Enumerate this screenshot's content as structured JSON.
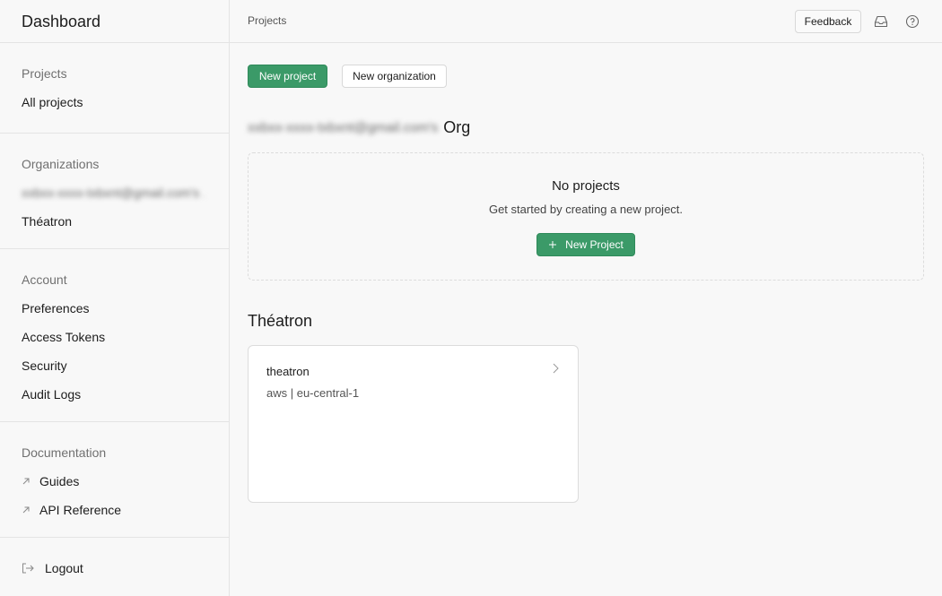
{
  "sidebar": {
    "title": "Dashboard",
    "projects": {
      "title": "Projects",
      "items": [
        {
          "label": "All projects"
        }
      ]
    },
    "organizations": {
      "title": "Organizations",
      "items": [
        {
          "label": "xxbxx-xxxx-txbxnt@gmail.com's ..."
        },
        {
          "label": "Théatron"
        }
      ]
    },
    "account": {
      "title": "Account",
      "items": [
        {
          "label": "Preferences"
        },
        {
          "label": "Access Tokens"
        },
        {
          "label": "Security"
        },
        {
          "label": "Audit Logs"
        }
      ]
    },
    "documentation": {
      "title": "Documentation",
      "items": [
        {
          "label": "Guides",
          "icon": "external-link-icon"
        },
        {
          "label": "API Reference",
          "icon": "external-link-icon"
        }
      ]
    },
    "logout": {
      "label": "Logout",
      "icon": "logout-icon"
    }
  },
  "topbar": {
    "breadcrumb": "Projects",
    "feedback_label": "Feedback",
    "icons": [
      "inbox-icon",
      "help-icon"
    ]
  },
  "main": {
    "new_project_label": "New project",
    "new_org_label": "New organization",
    "orgs": [
      {
        "name_prefix": "xxbxx-xxxx-txbxnt@gmail.com's",
        "name_suffix": "Org",
        "empty": {
          "title": "No projects",
          "subtitle": "Get started by creating a new project.",
          "button_label": "New Project"
        }
      },
      {
        "name": "Théatron",
        "projects": [
          {
            "name": "theatron",
            "region": "aws | eu-central-1"
          }
        ]
      }
    ]
  },
  "colors": {
    "accent": "#3b9a68",
    "background": "#f8f8f8",
    "border": "#e4e4e4",
    "muted_text": "#707070"
  }
}
